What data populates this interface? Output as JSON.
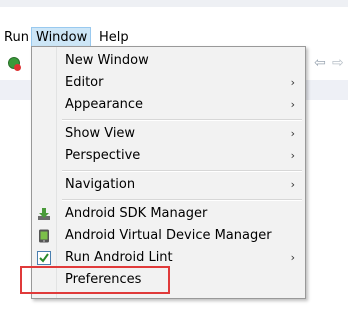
{
  "menubar": {
    "items": [
      {
        "label": "Run"
      },
      {
        "label": "Window"
      },
      {
        "label": "Help"
      }
    ]
  },
  "window_menu": {
    "items": [
      {
        "label": "New Window",
        "submenu": false
      },
      {
        "label": "Editor",
        "submenu": true,
        "arrow": "›"
      },
      {
        "label": "Appearance",
        "submenu": true,
        "arrow": "›"
      },
      {
        "label": "Show View",
        "submenu": true,
        "arrow": "›"
      },
      {
        "label": "Perspective",
        "submenu": true,
        "arrow": "›"
      },
      {
        "label": "Navigation",
        "submenu": true,
        "arrow": "›"
      },
      {
        "label": "Android SDK Manager",
        "submenu": false,
        "icon": "download-icon"
      },
      {
        "label": "Android Virtual Device Manager",
        "submenu": false,
        "icon": "phone-icon"
      },
      {
        "label": "Run Android Lint",
        "submenu": true,
        "arrow": "›",
        "icon": "checkmark-icon"
      },
      {
        "label": "Preferences",
        "submenu": false
      }
    ]
  },
  "toolbar": {
    "icons": [
      "run-icon",
      "back-arrow-icon",
      "forward-arrow-icon"
    ],
    "back_glyph": "⇦",
    "forward_glyph": "⇨"
  },
  "annotation": {
    "color": "#e03a3a",
    "target": "Preferences"
  },
  "colors": {
    "menu_active_bg": "#cde6f7",
    "menu_bg": "#f2f2f2",
    "highlight": "#e03a3a"
  }
}
